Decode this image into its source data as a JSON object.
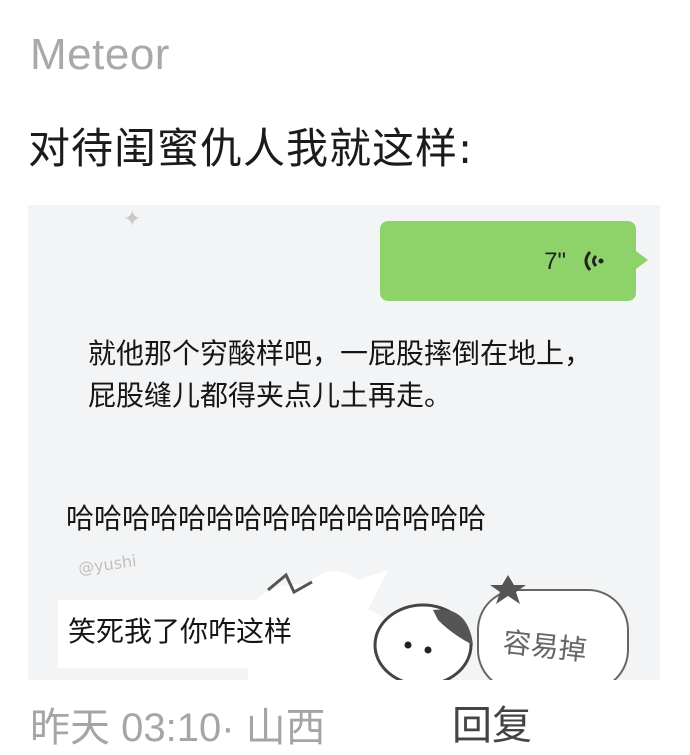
{
  "post": {
    "author": "Meteor",
    "text": "对待闺蜜仇人我就这样:",
    "timestamp_location": "昨天 03:10· 山西",
    "reply_label": "回复"
  },
  "image": {
    "voice_message": {
      "duration": "7\""
    },
    "caption_1": "就他那个穷酸样吧，一屁股摔倒在地上，屁股缝儿都得夹点儿土再走。",
    "caption_2": "哈哈哈哈哈哈哈哈哈哈哈哈哈哈哈",
    "caption_3": "笑死我了你咋这样",
    "sticker_text": "容易掉",
    "watermark": "@yushi"
  },
  "colors": {
    "bubble_green": "#8ed36a",
    "muted_gray": "#a9a9a9"
  }
}
